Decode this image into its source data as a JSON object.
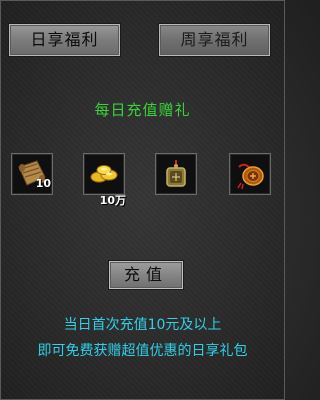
{
  "tabs": [
    {
      "label": "日享福利",
      "active": true
    },
    {
      "label": "周享福利",
      "active": false
    }
  ],
  "title": "每日充值赠礼",
  "rewards": [
    {
      "icon": "scroll-icon",
      "quantity": "10"
    },
    {
      "icon": "gold-ingots-icon",
      "quantity": "10万"
    },
    {
      "icon": "bronze-medallion-icon",
      "quantity": ""
    },
    {
      "icon": "red-amulet-icon",
      "quantity": ""
    }
  ],
  "recharge_button": "充值",
  "description": [
    "当日首次充值10元及以上",
    "即可免费获赠超值优惠的日享礼包"
  ],
  "colors": {
    "title": "#3bd13b",
    "description": "#2fd0e8",
    "quantity": "#ffffff"
  }
}
